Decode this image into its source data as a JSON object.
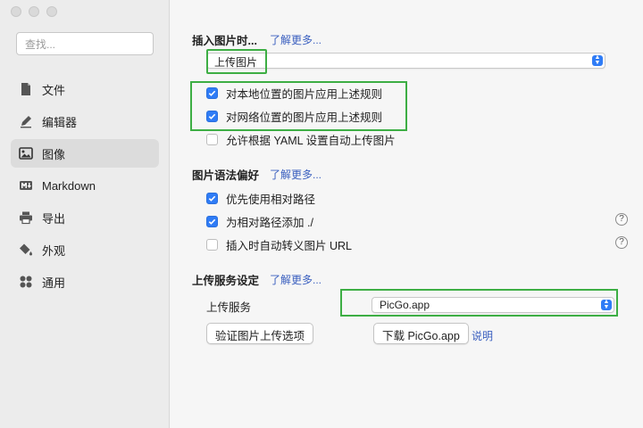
{
  "sidebar": {
    "search_placeholder": "查找...",
    "items": [
      {
        "label": "文件",
        "icon": "file-icon"
      },
      {
        "label": "编辑器",
        "icon": "pen-icon"
      },
      {
        "label": "图像",
        "icon": "image-icon",
        "active": true
      },
      {
        "label": "Markdown",
        "icon": "markdown-icon"
      },
      {
        "label": "导出",
        "icon": "printer-icon"
      },
      {
        "label": "外观",
        "icon": "paint-bucket-icon"
      },
      {
        "label": "通用",
        "icon": "grid-icon"
      }
    ]
  },
  "insert": {
    "title": "插入图片时...",
    "learn_more": "了解更多...",
    "action_value": "上传图片",
    "options": [
      {
        "label": "对本地位置的图片应用上述规则",
        "checked": true
      },
      {
        "label": "对网络位置的图片应用上述规则",
        "checked": true
      },
      {
        "label": "允许根据 YAML 设置自动上传图片",
        "checked": false
      }
    ]
  },
  "syntax": {
    "title": "图片语法偏好",
    "learn_more": "了解更多...",
    "options": [
      {
        "label": "优先使用相对路径",
        "checked": true
      },
      {
        "label": "为相对路径添加 ./",
        "checked": true
      },
      {
        "label": "插入时自动转义图片 URL",
        "checked": false
      }
    ],
    "help_glyph": "?"
  },
  "upload": {
    "title": "上传服务设定",
    "learn_more": "了解更多...",
    "service_label": "上传服务",
    "service_value": "PicGo.app",
    "verify_button": "验证图片上传选项",
    "download_button": "下载 PicGo.app",
    "explain_link": "说明"
  },
  "colors": {
    "accent": "#2f7cf6",
    "link": "#3a5fbf",
    "highlight": "#3dae44"
  }
}
